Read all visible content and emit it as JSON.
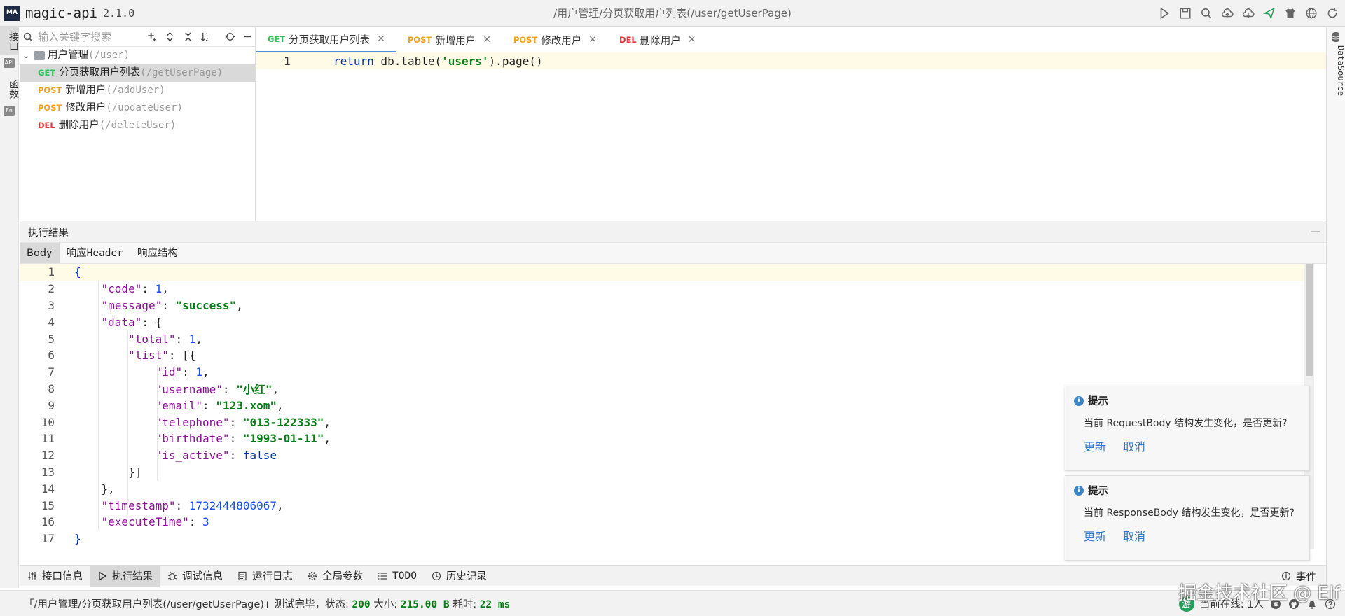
{
  "app": {
    "name": "magic-api",
    "version": "2.1.0",
    "logo_text": "MA"
  },
  "window_title": "/用户管理/分页获取用户列表(/user/getUserPage)",
  "left_strip": {
    "tab1": "接口",
    "tab2": "函数",
    "icon1": "API",
    "icon2": "Fn"
  },
  "tree": {
    "search_placeholder": "输入关键字搜索",
    "group": {
      "label": "用户管理",
      "path": "(/user)"
    },
    "items": [
      {
        "method": "GET",
        "label": "分页获取用户列表",
        "path": "(/getUserPage)"
      },
      {
        "method": "POST",
        "label": "新增用户",
        "path": "(/addUser)"
      },
      {
        "method": "POST",
        "label": "修改用户",
        "path": "(/updateUser)"
      },
      {
        "method": "DEL",
        "label": "删除用户",
        "path": "(/deleteUser)"
      }
    ]
  },
  "editor": {
    "tabs": [
      {
        "method": "GET",
        "label": "分页获取用户列表",
        "close": "✕"
      },
      {
        "method": "POST",
        "label": "新增用户",
        "close": "✕"
      },
      {
        "method": "POST",
        "label": "修改用户",
        "close": "✕"
      },
      {
        "method": "DEL",
        "label": "删除用户",
        "close": "✕"
      }
    ],
    "line_number": "1",
    "code": {
      "kw": "return",
      "pre": " db.table(",
      "str": "'users'",
      "post": ").page()"
    }
  },
  "right_strip": {
    "label": "DataSource"
  },
  "results": {
    "title": "执行结果",
    "minimize": "—",
    "subtabs": [
      "Body",
      "响应Header",
      "响应结构"
    ],
    "json_lines": [
      {
        "n": "1",
        "html": "<span class='jb'>{</span>"
      },
      {
        "n": "2",
        "html": "    <span class='jk'>\"code\"</span>: <span class='jn'>1</span>,"
      },
      {
        "n": "3",
        "html": "    <span class='jk'>\"message\"</span>: <span class='jsv'>\"success\"</span>,"
      },
      {
        "n": "4",
        "html": "    <span class='jk'>\"data\"</span>: {"
      },
      {
        "n": "5",
        "html": "        <span class='jk'>\"total\"</span>: <span class='jn'>1</span>,"
      },
      {
        "n": "6",
        "html": "        <span class='jk'>\"list\"</span>: [{"
      },
      {
        "n": "7",
        "html": "            <span class='jk'>\"id\"</span>: <span class='jn'>1</span>,"
      },
      {
        "n": "8",
        "html": "            <span class='jk'>\"username\"</span>: <span class='jsv'>\"小红\"</span>,"
      },
      {
        "n": "9",
        "html": "            <span class='jk'>\"email\"</span>: <span class='jsv'>\"123.xom\"</span>,"
      },
      {
        "n": "10",
        "html": "            <span class='jk'>\"telephone\"</span>: <span class='jsv'>\"013-122333\"</span>,"
      },
      {
        "n": "11",
        "html": "            <span class='jk'>\"birthdate\"</span>: <span class='jsv'>\"1993-01-11\"</span>,"
      },
      {
        "n": "12",
        "html": "            <span class='jk'>\"is_active\"</span>: <span class='jb'>false</span>"
      },
      {
        "n": "13",
        "html": "        }]"
      },
      {
        "n": "14",
        "html": "    },"
      },
      {
        "n": "15",
        "html": "    <span class='jk'>\"timestamp\"</span>: <span class='jn'>1732444806067</span>,"
      },
      {
        "n": "16",
        "html": "    <span class='jk'>\"executeTime\"</span>: <span class='jn'>3</span>"
      },
      {
        "n": "17",
        "html": "<span class='jb'>}</span>"
      }
    ]
  },
  "notifications": [
    {
      "title": "提示",
      "message": "当前 RequestBody 结构发生变化，是否更新?",
      "ok": "更新",
      "cancel": "取消"
    },
    {
      "title": "提示",
      "message": "当前 ResponseBody 结构发生变化，是否更新?",
      "ok": "更新",
      "cancel": "取消"
    }
  ],
  "bottom_toolbar": {
    "items": [
      "接口信息",
      "执行结果",
      "调试信息",
      "运行日志",
      "全局参数",
      "TODO",
      "历史记录"
    ],
    "events": "事件"
  },
  "status": {
    "prefix": "「/用户管理/分页获取用户列表(/user/getUserPage)」测试完毕，状态: ",
    "code": "200",
    "size_label": " 大小: ",
    "size": "215.00 B",
    "time_label": " 耗时: ",
    "time": "22 ms",
    "online_avatar": "游",
    "online": "当前在线: 1人"
  },
  "watermark": "掘金技术社区 @ Elf"
}
